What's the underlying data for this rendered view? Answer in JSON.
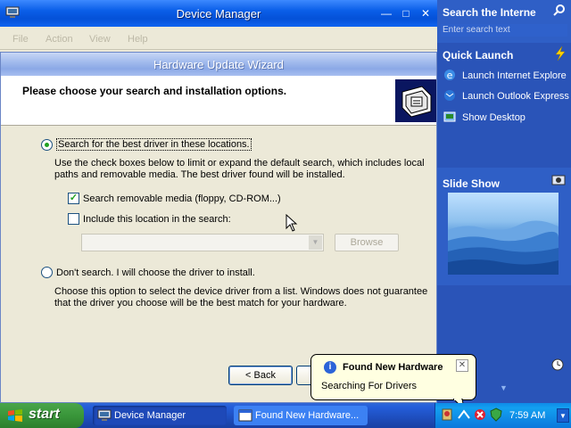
{
  "device_manager": {
    "title": "Device Manager",
    "menu": [
      "File",
      "Action",
      "View",
      "Help"
    ]
  },
  "wizard": {
    "title": "Hardware Update Wizard",
    "heading": "Please choose your search and installation options.",
    "option_search": "Search for the best driver in these locations.",
    "option_search_desc": "Use the check boxes below to limit or expand the default search, which includes local paths and removable media. The best driver found will be installed.",
    "check_removable": "Search removable media (floppy, CD-ROM...)",
    "check_include": "Include this location in the search:",
    "location_value": "",
    "browse_label": "Browse",
    "option_dont_search": "Don't search. I will choose the driver to install.",
    "option_dont_search_desc": "Choose this option to select the device driver from a list.  Windows does not guarantee that the driver you choose will be the best match for your hardware.",
    "back_label": "< Back",
    "search_selected": true,
    "removable_checked": true,
    "include_checked": false
  },
  "sidebar": {
    "search_title": "Search the Interne",
    "search_placeholder": "Enter search text",
    "quick_launch_title": "Quick Launch",
    "quick_launch_items": [
      "Launch Internet Explore",
      "Launch Outlook Express",
      "Show Desktop"
    ],
    "slideshow_title": "Slide Show"
  },
  "balloon": {
    "title": "Found New Hardware",
    "message": "Searching For Drivers"
  },
  "taskbar": {
    "start_label": "start",
    "tasks": [
      "Device Manager",
      "Found New Hardware..."
    ],
    "clock": "7:59 AM"
  },
  "colors": {
    "titlebar_blue": "#0a5ee8",
    "sidebar_blue": "#2a54b8",
    "start_green": "#39963a",
    "balloon_yellow": "#ffffe1"
  }
}
